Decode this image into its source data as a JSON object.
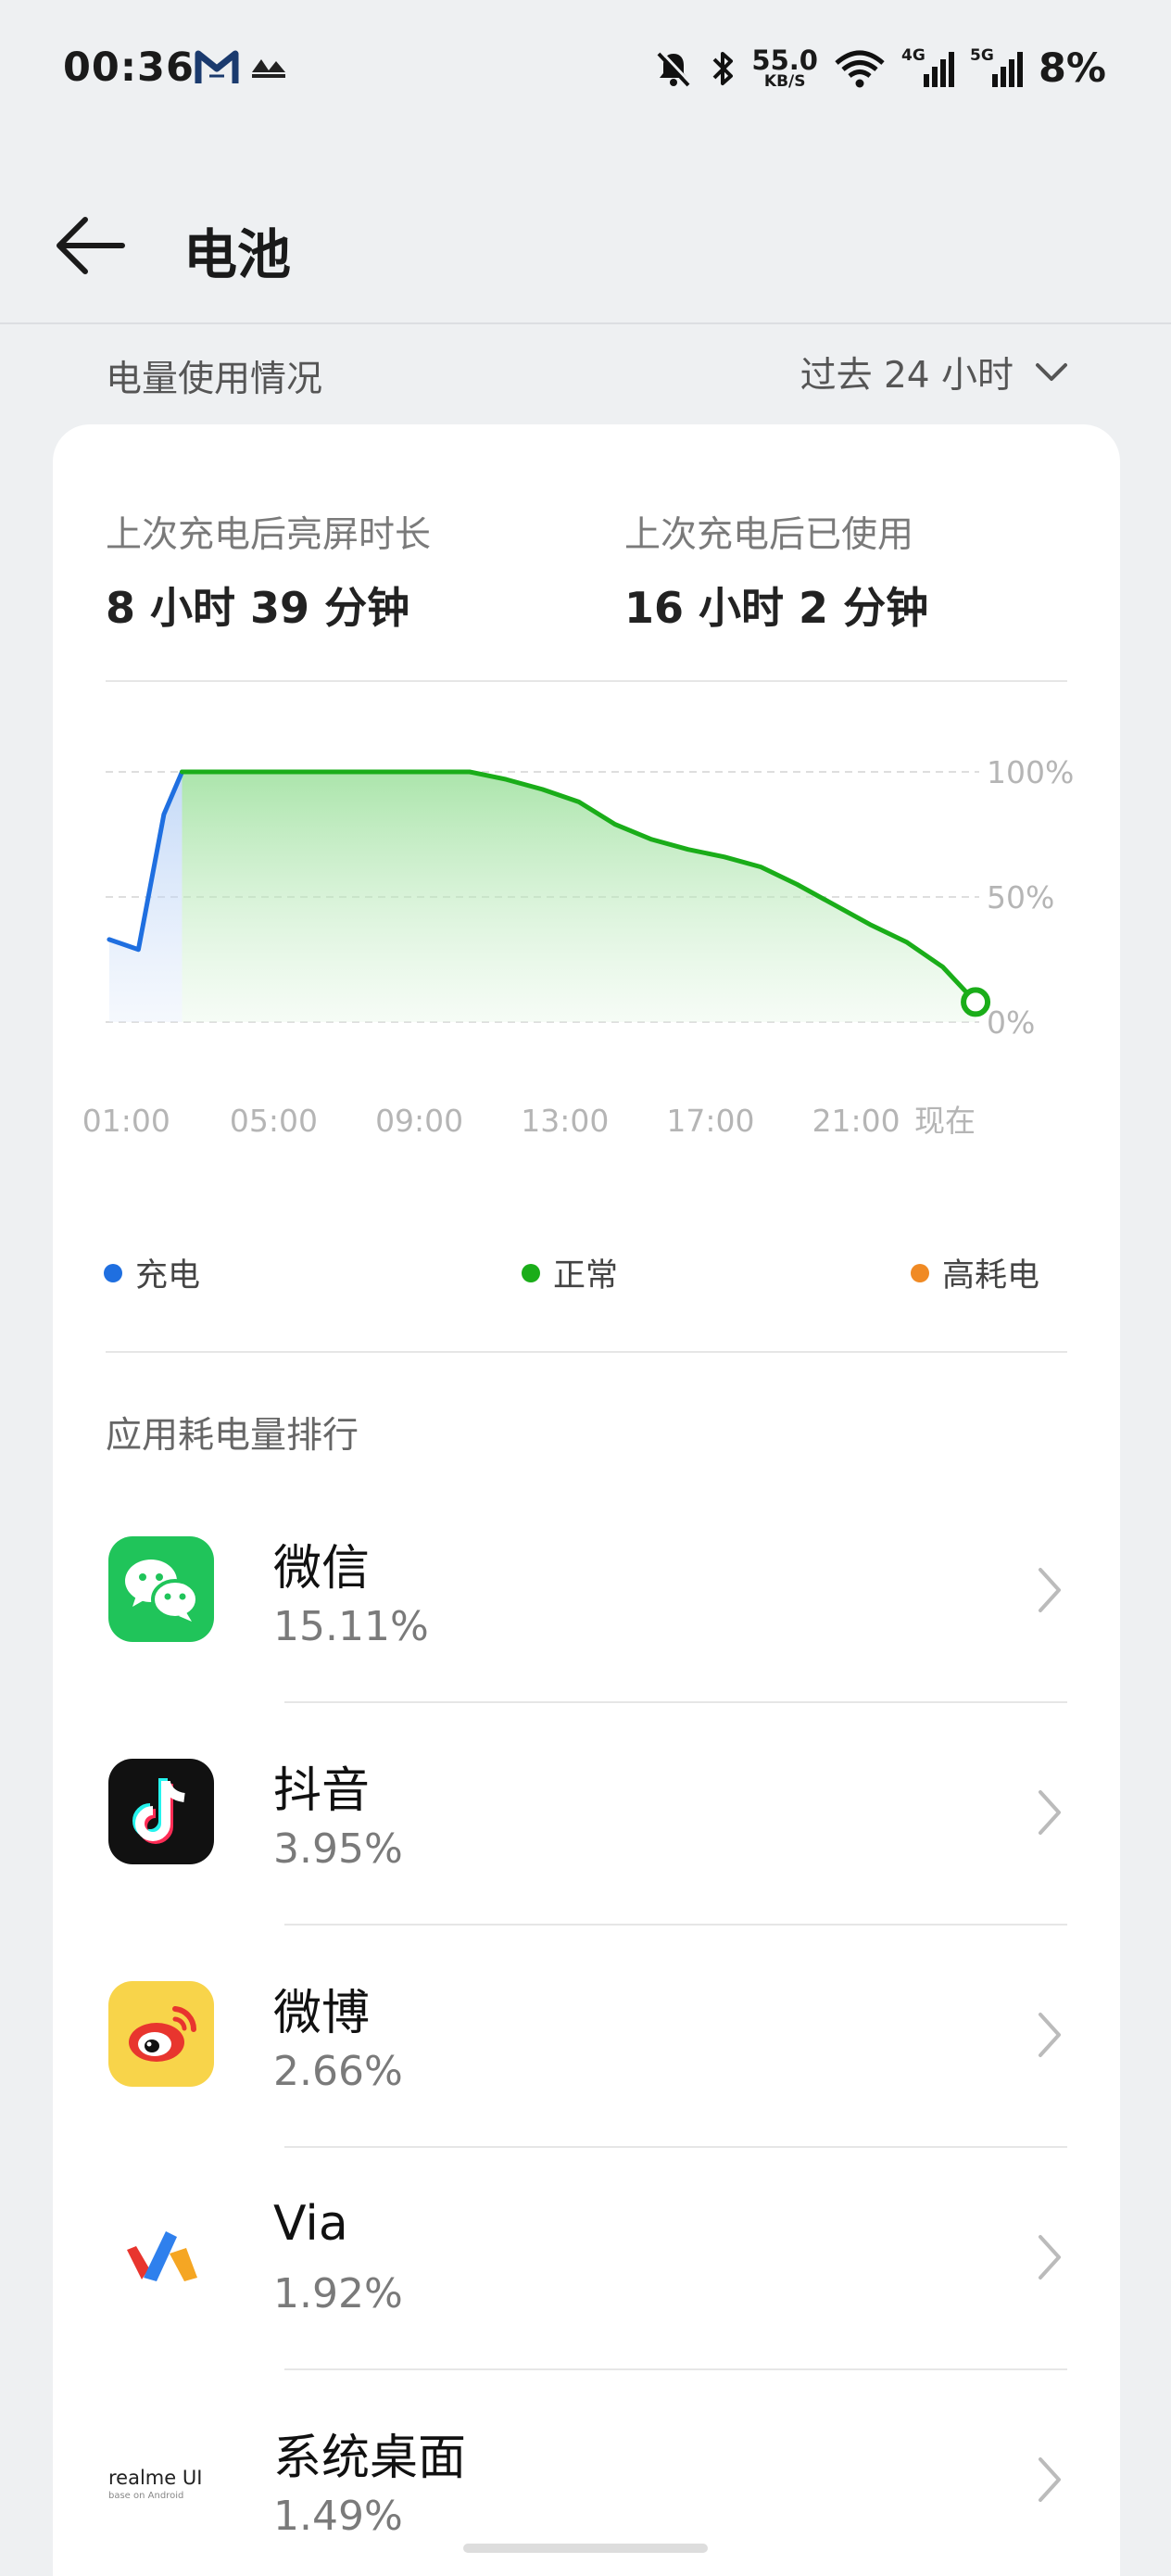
{
  "status_bar": {
    "time": "00:36",
    "speed_value": "55.0",
    "speed_unit": "KB/S",
    "net1": "4G",
    "net2": "5G",
    "battery": "8%"
  },
  "header": {
    "title": "电池"
  },
  "usage": {
    "heading": "电量使用情况",
    "range": "过去 24 小时"
  },
  "stats": {
    "screen_on_label": "上次充电后亮屏时长",
    "screen_on_value": "8 小时 39 分钟",
    "used_label": "上次充电后已使用",
    "used_value": "16 小时 2 分钟"
  },
  "chart_data": {
    "type": "area",
    "x_ticks": [
      "01:00",
      "05:00",
      "09:00",
      "13:00",
      "17:00",
      "21:00",
      "现在"
    ],
    "y_ticks": [
      "100%",
      "50%",
      "0%"
    ],
    "ylim": [
      0,
      100
    ],
    "xlim": [
      0,
      24
    ],
    "series": [
      {
        "name": "充电",
        "color": "#1f6fe0",
        "x": [
          0.1,
          0.9,
          1.6,
          2.1
        ],
        "y": [
          33,
          29,
          83,
          100
        ]
      },
      {
        "name": "正常",
        "color": "#1aad19",
        "x": [
          2.1,
          4,
          6,
          8,
          10,
          11,
          12,
          13,
          14,
          15,
          16,
          17,
          18,
          19,
          20,
          21,
          22,
          23,
          23.9
        ],
        "y": [
          100,
          100,
          100,
          100,
          100,
          97,
          93,
          88,
          79,
          73,
          69,
          66,
          62,
          55,
          47,
          39,
          32,
          22,
          8
        ]
      },
      {
        "name": "高耗电",
        "color": "#f08a24",
        "x": [],
        "y": []
      }
    ],
    "grid": true,
    "legend_position": "bottom"
  },
  "ranking": {
    "title": "应用耗电量排行",
    "apps": [
      {
        "name": "微信",
        "percent": "15.11%",
        "icon": "wechat-icon"
      },
      {
        "name": "抖音",
        "percent": "3.95%",
        "icon": "douyin-icon"
      },
      {
        "name": "微博",
        "percent": "2.66%",
        "icon": "weibo-icon"
      },
      {
        "name": "Via",
        "percent": "1.92%",
        "icon": "via-icon"
      },
      {
        "name": "系统桌面",
        "percent": "1.49%",
        "icon": "realme-ui-icon",
        "logo_text": "realme UI",
        "logo_sub": "base on Android"
      }
    ]
  }
}
